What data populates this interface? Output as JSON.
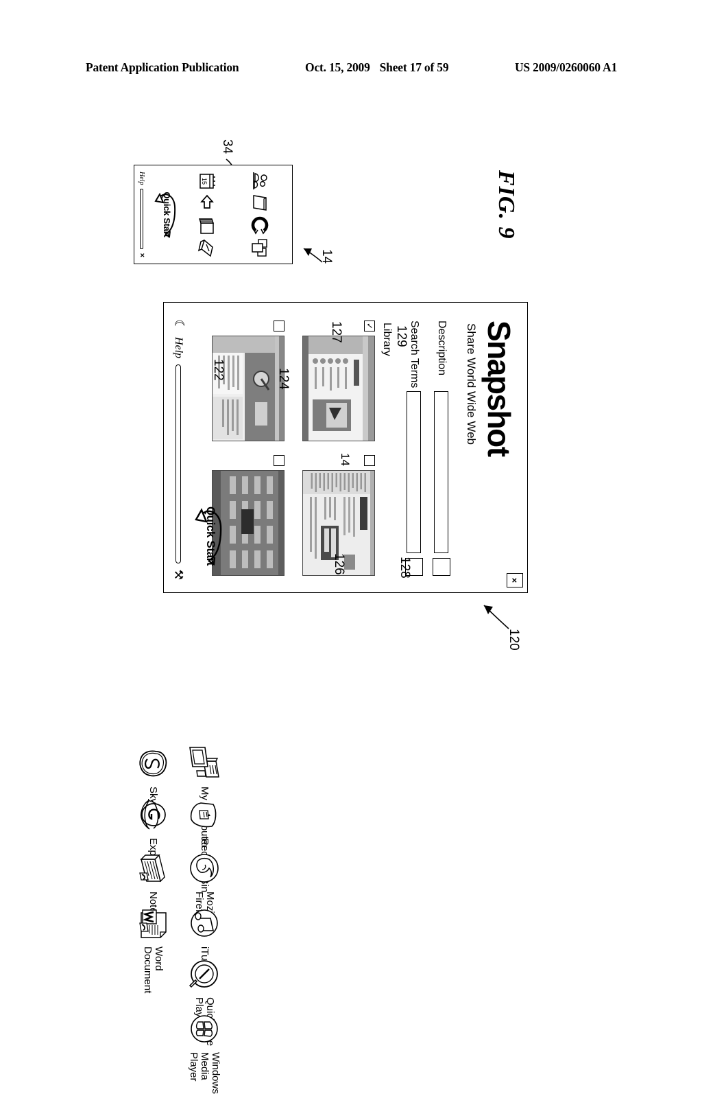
{
  "header": {
    "publication": "Patent Application Publication",
    "date": "Oct. 15, 2009",
    "sheet": "Sheet 17 of 59",
    "number": "US 2009/0260060 A1"
  },
  "figure": {
    "label": "FIG. 9"
  },
  "quickstart_window": {
    "ref": "14",
    "icon_ref": "34",
    "logo_text": "Quick Start",
    "help_label": "Help",
    "close_label": "×",
    "icons": [
      {
        "name": "people-group-icon"
      },
      {
        "name": "folder-icon"
      },
      {
        "name": "refresh-circle-icon"
      },
      {
        "name": "stacked-pages-icon"
      },
      {
        "name": "calendar-icon"
      },
      {
        "name": "undo-arrow-icon"
      },
      {
        "name": "book-icon"
      },
      {
        "name": "open-notebook-icon"
      }
    ]
  },
  "snapshot_window": {
    "ref": "120",
    "title": "Snapshot",
    "subtitle": "Share World Wide Web",
    "close_label": "×",
    "fields": [
      {
        "label": "Description",
        "ref": "122",
        "value": "",
        "button_name": "description-browse-button"
      },
      {
        "label": "Search Terms",
        "ref": "124",
        "value": "",
        "button_name": "search-terms-browse-button"
      }
    ],
    "library_label": "Library",
    "cursor_ref": "14",
    "thumbnails": [
      {
        "ref": "126",
        "checked": true,
        "check_glyph": "✓",
        "kind": "browser-window"
      },
      {
        "ref": "127",
        "checked": false,
        "check_glyph": "",
        "kind": "portal-page"
      },
      {
        "ref": "128",
        "checked": false,
        "check_glyph": "",
        "kind": "media-page"
      },
      {
        "ref": "129",
        "checked": false,
        "check_glyph": "",
        "kind": "dark-page"
      }
    ],
    "bottom_bar": {
      "moon_icon": "☾",
      "help_label": "Help",
      "tools_icon": "⚒",
      "logo_text": "Quick Start"
    }
  },
  "desktop_icons": [
    {
      "label": "My Computer",
      "icon": "my-computer-icon"
    },
    {
      "label": "Skype",
      "icon": "skype-icon"
    },
    {
      "label": "Recycle Bin",
      "icon": "recycle-bin-icon"
    },
    {
      "label": "Explorer",
      "icon": "internet-explorer-icon"
    },
    {
      "label": "Mozilla\nFirefox",
      "icon": "firefox-icon"
    },
    {
      "label": "Notepad",
      "icon": "notepad-icon"
    },
    {
      "label": "iTunes",
      "icon": "itunes-icon"
    },
    {
      "label": "Word\nDocument",
      "icon": "word-document-icon"
    },
    {
      "label": "QuickTime\nPlayer",
      "icon": "quicktime-icon"
    },
    {
      "label": "Windows\nMedia Player",
      "icon": "windows-media-player-icon"
    }
  ],
  "colors": {
    "ink": "#000000",
    "paper": "#ffffff",
    "thumb_fill": "#d8d8d8"
  }
}
